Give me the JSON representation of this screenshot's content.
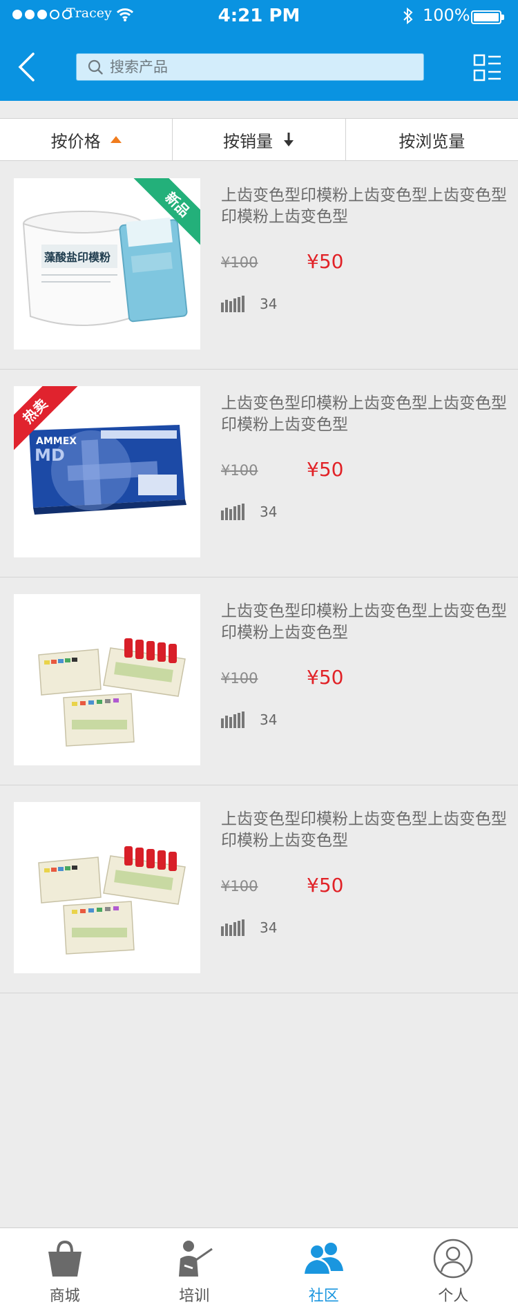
{
  "status_bar": {
    "carrier": "Tracey",
    "time": "4:21 PM",
    "battery": "100%"
  },
  "header": {
    "search_placeholder": "搜索产品"
  },
  "sort_bar": {
    "price": "按价格",
    "sales": "按销量",
    "views": "按浏览量"
  },
  "products": [
    {
      "title": "上齿变色型印模粉上齿变色型上齿变色型印模粉上齿变色型",
      "old_price": "¥100",
      "price": "¥50",
      "views": "34",
      "badge": "新品",
      "box_label": "藻酸盐印模粉"
    },
    {
      "title": "上齿变色型印模粉上齿变色型上齿变色型印模粉上齿变色型",
      "old_price": "¥100",
      "price": "¥50",
      "views": "34",
      "badge": "热卖",
      "box_brand": "AMMEX",
      "box_model": "MD"
    },
    {
      "title": "上齿变色型印模粉上齿变色型上齿变色型印模粉上齿变色型",
      "old_price": "¥100",
      "price": "¥50",
      "views": "34"
    },
    {
      "title": "上齿变色型印模粉上齿变色型上齿变色型印模粉上齿变色型",
      "old_price": "¥100",
      "price": "¥50",
      "views": "34"
    }
  ],
  "tabs": [
    {
      "label": "商城",
      "icon": "shopping-bag-icon"
    },
    {
      "label": "培训",
      "icon": "teacher-icon"
    },
    {
      "label": "社区",
      "icon": "community-icon",
      "active": true
    },
    {
      "label": "个人",
      "icon": "person-icon"
    }
  ],
  "colors": {
    "header": "#0a93e1",
    "price": "#e12227",
    "accent_arrow": "#f07c1d",
    "badge_new": "#23b07a",
    "badge_hot": "#e0232e",
    "tab_active": "#1a96df"
  }
}
